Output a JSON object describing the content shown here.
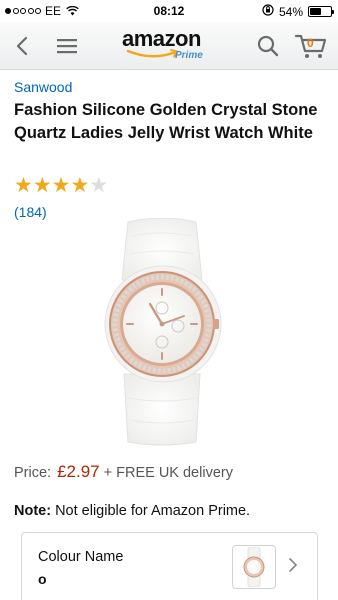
{
  "status_bar": {
    "carrier": "EE",
    "time": "08:12",
    "battery": "54%",
    "signal_bars_filled": 1,
    "signal_bars_total": 5,
    "battery_level": 0.54
  },
  "nav": {
    "logo_text": "amazon",
    "logo_subtext": "Prime",
    "cart_count": "0",
    "icons": [
      "back-icon",
      "menu-icon",
      "search-icon",
      "cart-icon"
    ]
  },
  "product": {
    "brand": "Sanwood",
    "title": "Fashion Silicone Golden Crystal Stone Quartz Ladies Jelly Wrist Watch White",
    "rating": 4,
    "rating_max": 5,
    "review_count": "(184)",
    "price_label": "Price:",
    "price": "£2.97",
    "delivery": "+ FREE UK delivery",
    "note_label": "Note:",
    "note_text": "Not eligible for Amazon Prime."
  },
  "variation": {
    "label": "Colour Name",
    "value": "o"
  },
  "colors": {
    "link": "#0066c0",
    "price": "#b12704",
    "star": "#f0a81c",
    "cart_accent": "#e47911"
  }
}
